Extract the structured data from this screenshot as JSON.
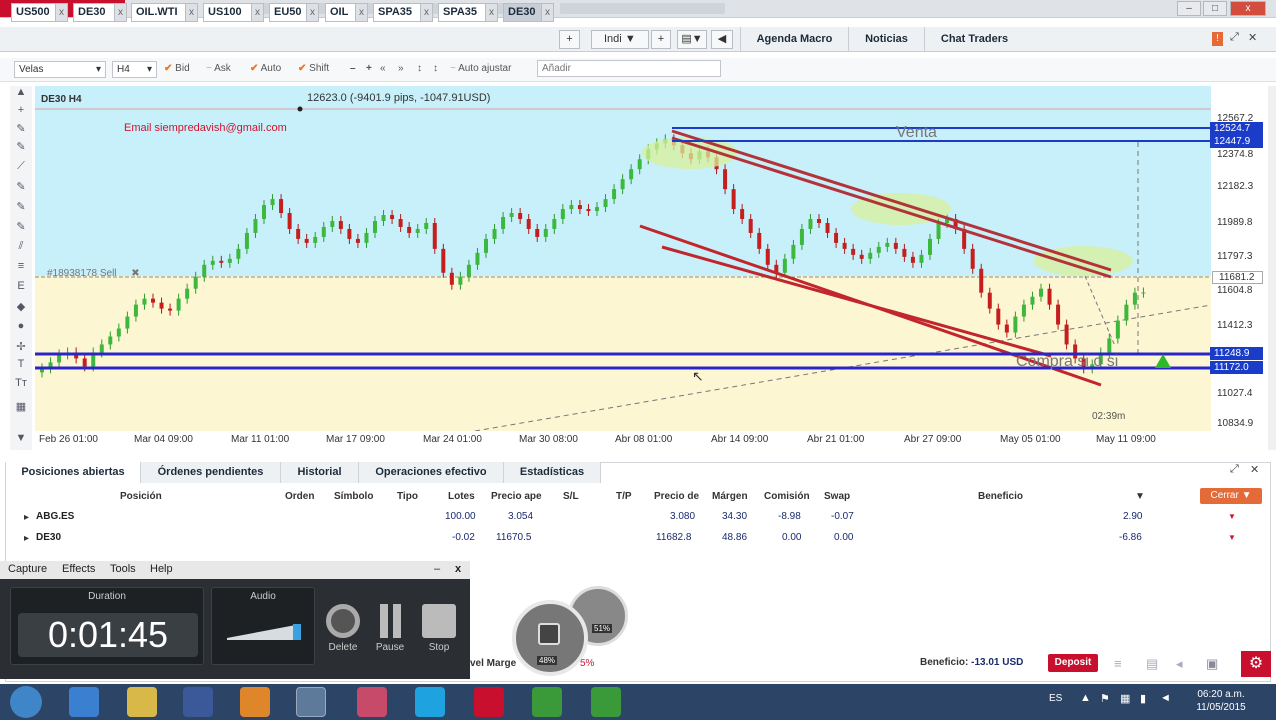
{
  "window": {
    "close_label": "x",
    "max_label": "□",
    "min_label": "–"
  },
  "tabs": [
    {
      "label": "US500",
      "close": "x"
    },
    {
      "label": "DE30",
      "close": "x"
    },
    {
      "label": "OIL.WTI",
      "close": "x"
    },
    {
      "label": "US100",
      "close": "x"
    },
    {
      "label": "EU50",
      "close": "x"
    },
    {
      "label": "OIL",
      "close": "x"
    },
    {
      "label": "SPA35",
      "close": "x"
    },
    {
      "label": "SPA35",
      "close": "x"
    },
    {
      "label": "DE30",
      "close": "x"
    }
  ],
  "tabbar": {
    "add": "+",
    "indi": "Indi",
    "indi_add": "+",
    "layout_icon": "▤",
    "back": "◀"
  },
  "right_tabs": [
    "Agenda Macro",
    "Noticias",
    "Chat Traders"
  ],
  "toolbar": {
    "chart_type": "Velas",
    "timeframe": "H4",
    "bid": "Bid",
    "ask": "Ask",
    "auto": "Auto",
    "shift": "Shift",
    "minus": "–",
    "plus": "+",
    "ff": "»",
    "auto_adjust": "Auto ajustar",
    "add_placeholder": "Añadir"
  },
  "chart": {
    "symbol": "DE30 H4",
    "measure": "12623.0 (-9401.9 pips, -1047.91USD)",
    "email": "Email siempredavish@gmail.com",
    "order_label": "#18938178 Sell",
    "venta": "Venta",
    "annotation": "Compra si o si",
    "countdown": "02:39m",
    "y_ticks": [
      "12567.2",
      "12374.8",
      "12182.3",
      "11989.8",
      "11797.3",
      "11604.8",
      "11412.3",
      "11027.4",
      "10834.9"
    ],
    "y_boxes": [
      "12524.7",
      "12447.9",
      "11248.9",
      "11172.0"
    ],
    "current_price": "11681.2",
    "x_ticks": [
      "Feb 26 01:00",
      "Mar 04 09:00",
      "Mar 11 01:00",
      "Mar 17 09:00",
      "Mar 24 01:00",
      "Mar 30 08:00",
      "Abr 08 01:00",
      "Abr 14 09:00",
      "Abr 21 01:00",
      "Abr 27 09:00",
      "May 05 01:00",
      "May 11 09:00"
    ]
  },
  "bottom": {
    "tabs": [
      "Posiciones abiertas",
      "Órdenes pendientes",
      "Historial",
      "Operaciones efectivo",
      "Estadísticas"
    ],
    "headers": [
      "Posición",
      "Orden",
      "Símbolo",
      "Tipo",
      "Lotes",
      "Precio ape",
      "S/L",
      "T/P",
      "Precio de c",
      "Márgen",
      "Comisión",
      "Swap",
      "Beneficio"
    ],
    "close_all": "Cerrar",
    "rows": [
      {
        "name": "ABG.ES",
        "lots": "100.00",
        "open": "3.054",
        "close": "3.080",
        "margin": "34.30",
        "comm": "-8.98",
        "swap": "-0.07",
        "profit": "2.90"
      },
      {
        "name": "DE30",
        "lots": "-0.02",
        "open": "11670.5",
        "close": "11682.8",
        "margin": "48.86",
        "comm": "0.00",
        "swap": "0.00",
        "profit": "-6.86"
      }
    ],
    "level_label": "vel Marge",
    "level_pct": "5%",
    "beneficio_label": "Beneficio:",
    "beneficio_value": "-13.01 USD",
    "deposit": "Deposit"
  },
  "recorder": {
    "menu": [
      "Capture",
      "Effects",
      "Tools",
      "Help"
    ],
    "duration_label": "Duration",
    "audio_label": "Audio",
    "time": "0:01:45",
    "buttons": [
      "Delete",
      "Pause",
      "Stop"
    ],
    "minimize": "–",
    "close": "x"
  },
  "gauges": {
    "left": "48%",
    "right": "51%"
  },
  "taskbar": {
    "lang": "ES",
    "time": "06:20 a.m.",
    "date": "11/05/2015"
  },
  "chart_data": {
    "type": "line",
    "candles": [
      11300,
      11330,
      11370,
      11380,
      11350,
      11310,
      11380,
      11420,
      11460,
      11500,
      11560,
      11620,
      11650,
      11630,
      11600,
      11590,
      11650,
      11700,
      11760,
      11820,
      11840,
      11830,
      11850,
      11900,
      11980,
      12050,
      12120,
      12150,
      12080,
      12000,
      11950,
      11930,
      11960,
      12010,
      12040,
      12000,
      11950,
      11930,
      11980,
      12040,
      12070,
      12050,
      12010,
      11980,
      12000,
      12030,
      11900,
      11780,
      11720,
      11760,
      11820,
      11880,
      11950,
      12000,
      12060,
      12080,
      12050,
      12000,
      11960,
      12000,
      12050,
      12100,
      12120,
      12100,
      12090,
      12110,
      12150,
      12200,
      12250,
      12300,
      12350,
      12400,
      12430,
      12450,
      12420,
      12380,
      12350,
      12390,
      12360,
      12300,
      12200,
      12100,
      12050,
      11980,
      11900,
      11820,
      11780,
      11850,
      11920,
      12000,
      12050,
      12030,
      11980,
      11930,
      11900,
      11870,
      11850,
      11880,
      11910,
      11930,
      11900,
      11860,
      11830,
      11870,
      11950,
      12030,
      12050,
      12000,
      11900,
      11800,
      11680,
      11600,
      11520,
      11480,
      11560,
      11620,
      11660,
      11700,
      11620,
      11520,
      11420,
      11350,
      11300,
      11320,
      11380,
      11450,
      11540,
      11620,
      11680,
      11681
    ]
  }
}
